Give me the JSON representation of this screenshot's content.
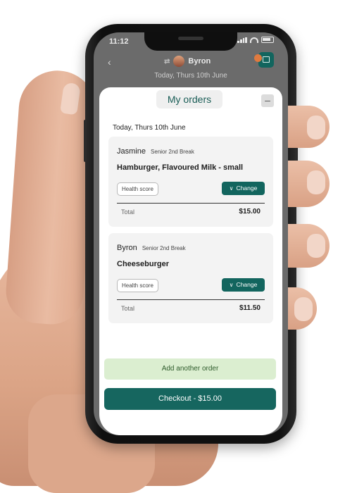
{
  "status": {
    "time": "11:12"
  },
  "header": {
    "user_name": "Byron",
    "background_date": "Today, Thurs 10th June"
  },
  "sheet": {
    "title": "My orders",
    "date": "Today, Thurs 10th June"
  },
  "orders": [
    {
      "name": "Jasmine",
      "break": "Senior 2nd Break",
      "item": "Hamburger, Flavoured Milk - small",
      "health_label": "Health score",
      "change_label": "Change",
      "total_label": "Total",
      "total_value": "$15.00"
    },
    {
      "name": "Byron",
      "break": "Senior 2nd Break",
      "item": "Cheeseburger",
      "health_label": "Health score",
      "change_label": "Change",
      "total_label": "Total",
      "total_value": "$11.50"
    }
  ],
  "actions": {
    "add_order_label": "Add another order",
    "checkout_label": "Checkout - $15.00"
  },
  "icons": {
    "back": "back-arrow-icon",
    "swap": "swap-icon",
    "cart": "cart-icon",
    "minimize": "minimize-icon",
    "chevron": "chevron-down-icon"
  },
  "colors": {
    "brand_green": "#12655e",
    "add_order_bg": "#dbeed0",
    "card_bg": "#f3f3f3"
  }
}
